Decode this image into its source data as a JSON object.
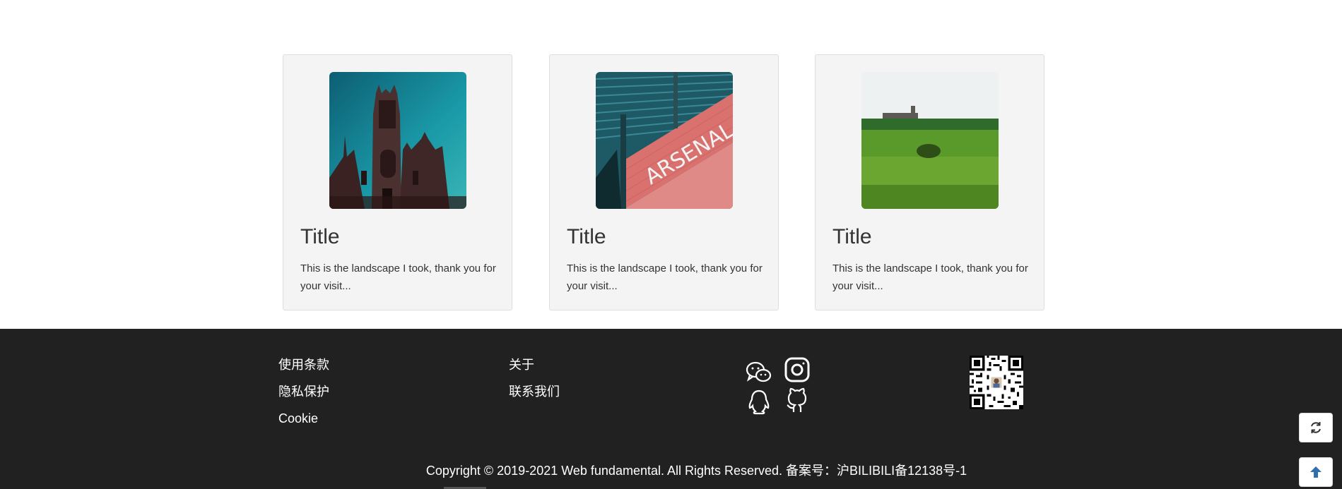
{
  "cards": [
    {
      "title": "Title",
      "description": "This is the landscape I took, thank you for your visit...",
      "image": "church-photo"
    },
    {
      "title": "Title",
      "description": "This is the landscape I took, thank you for your visit...",
      "image": "arsenal-sign-photo"
    },
    {
      "title": "Title",
      "description": "This is the landscape I took, thank you for your visit...",
      "image": "green-field-photo"
    }
  ],
  "footer": {
    "col1": [
      "使用条款",
      "隐私保护",
      "Cookie"
    ],
    "col2": [
      "关于",
      "联系我们"
    ],
    "social_icons": [
      "wechat-icon",
      "instagram-icon",
      "qq-icon",
      "github-icon"
    ],
    "qr_code": "qr-code-image",
    "copyright": "Copyright © 2019-2021 Web fundamental. All Rights Reserved. 备案号：沪BILIBILI备12138号-1"
  },
  "floating_buttons": [
    {
      "name": "refresh-button",
      "icon": "refresh-icon"
    },
    {
      "name": "back-to-top-button",
      "icon": "arrow-up-icon"
    }
  ],
  "colors": {
    "footer_bg": "#212121",
    "card_bg": "#f4f4f4",
    "accent": "#337ab7"
  }
}
